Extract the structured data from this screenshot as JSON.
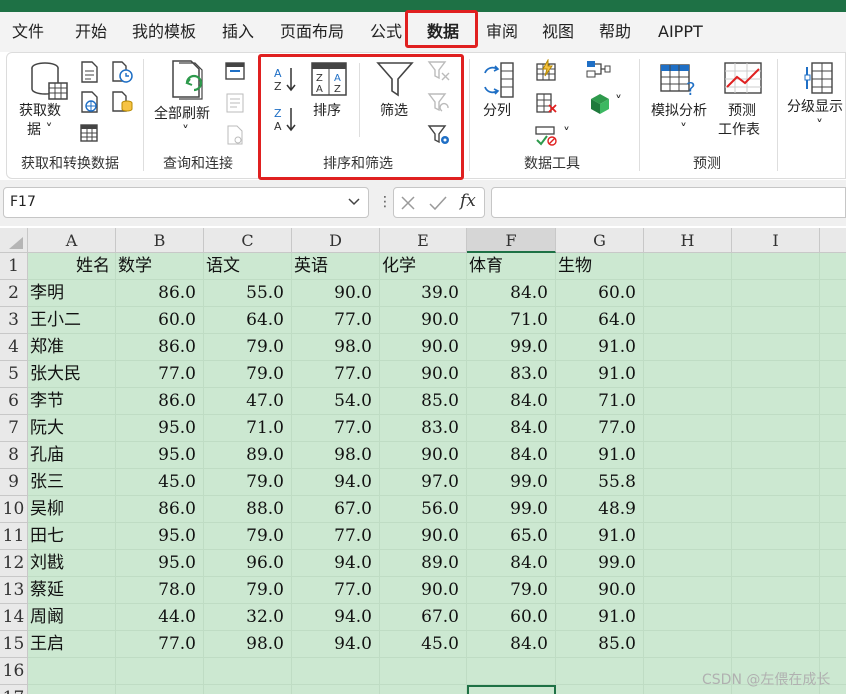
{
  "ribbon_tabs": [
    "文件",
    "开始",
    "我的模板",
    "插入",
    "页面布局",
    "公式",
    "数据",
    "审阅",
    "视图",
    "帮助",
    "AIPPT"
  ],
  "active_tab": "数据",
  "ribbon": {
    "get_data_line1": "获取数",
    "get_data_line2": "据",
    "get_data_group": "获取和转换数据",
    "refresh_all": "全部刷新",
    "query_group": "查询和连接",
    "sort": "排序",
    "filter": "筛选",
    "sort_filter_group": "排序和筛选",
    "split_column": "分列",
    "data_tools_group": "数据工具",
    "what_if": "模拟分析",
    "forecast_line1": "预测",
    "forecast_line2": "工作表",
    "forecast_group": "预测",
    "outline": "分级显示"
  },
  "formula_bar": {
    "name_box": "F17",
    "fx_label": "fx",
    "formula": ""
  },
  "sheet": {
    "columns": [
      "A",
      "B",
      "C",
      "D",
      "E",
      "F",
      "G",
      "H",
      "I"
    ],
    "selected_column": "F",
    "selected_cell": "F17",
    "header_row": [
      "姓名",
      "数学",
      "语文",
      "英语",
      "化学",
      "体育",
      "生物"
    ],
    "rows": [
      [
        "李明",
        "86.0",
        "55.0",
        "90.0",
        "39.0",
        "84.0",
        "60.0"
      ],
      [
        "王小二",
        "60.0",
        "64.0",
        "77.0",
        "90.0",
        "71.0",
        "64.0"
      ],
      [
        "郑准",
        "86.0",
        "79.0",
        "98.0",
        "90.0",
        "99.0",
        "91.0"
      ],
      [
        "张大民",
        "77.0",
        "79.0",
        "77.0",
        "90.0",
        "83.0",
        "91.0"
      ],
      [
        "李节",
        "86.0",
        "47.0",
        "54.0",
        "85.0",
        "84.0",
        "71.0"
      ],
      [
        "阮大",
        "95.0",
        "71.0",
        "77.0",
        "83.0",
        "84.0",
        "77.0"
      ],
      [
        "孔庙",
        "95.0",
        "89.0",
        "98.0",
        "90.0",
        "84.0",
        "91.0"
      ],
      [
        "张三",
        "45.0",
        "79.0",
        "94.0",
        "97.0",
        "99.0",
        "55.8"
      ],
      [
        "吴柳",
        "86.0",
        "88.0",
        "67.0",
        "56.0",
        "99.0",
        "48.9"
      ],
      [
        "田七",
        "95.0",
        "79.0",
        "77.0",
        "90.0",
        "65.0",
        "91.0"
      ],
      [
        "刘戡",
        "95.0",
        "96.0",
        "94.0",
        "89.0",
        "84.0",
        "99.0"
      ],
      [
        "蔡延",
        "78.0",
        "79.0",
        "77.0",
        "90.0",
        "79.0",
        "90.0"
      ],
      [
        "周阚",
        "44.0",
        "32.0",
        "94.0",
        "67.0",
        "60.0",
        "91.0"
      ],
      [
        "王启",
        "77.0",
        "98.0",
        "94.0",
        "45.0",
        "84.0",
        "85.0"
      ]
    ],
    "row_numbers": [
      "1",
      "2",
      "3",
      "4",
      "5",
      "6",
      "7",
      "8",
      "9",
      "10",
      "11",
      "12",
      "13",
      "14",
      "15",
      "16",
      "17"
    ]
  },
  "watermark": "CSDN @左偎在成长",
  "colors": {
    "accent": "#1e7145",
    "highlight": "#e02020",
    "grid_bg": "#cce8d1"
  }
}
